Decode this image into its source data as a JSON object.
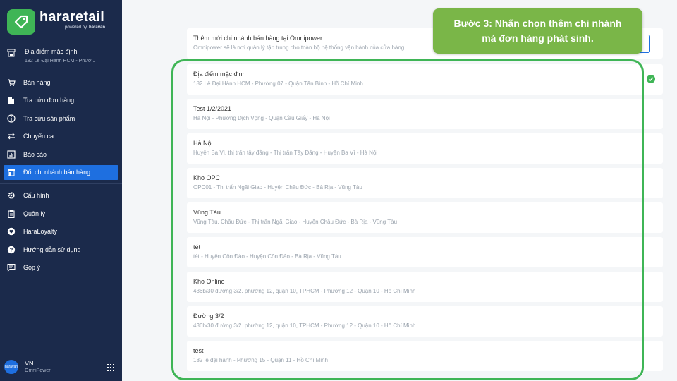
{
  "sidebar": {
    "logo_name": "hararetail",
    "logo_powered": "powered by",
    "logo_brand": "haravan",
    "location_title": "Địa điểm mặc định",
    "location_address": "182 Lê Đại Hành HCM - Phườ...",
    "menu": [
      {
        "label": "Bán hàng",
        "icon": "cart-icon"
      },
      {
        "label": "Tra cứu đơn hàng",
        "icon": "document-icon"
      },
      {
        "label": "Tra cứu sản phẩm",
        "icon": "info-icon"
      },
      {
        "label": "Chuyển ca",
        "icon": "swap-icon"
      },
      {
        "label": "Báo cáo",
        "icon": "chart-icon"
      },
      {
        "label": "Đổi chi nhánh bán hàng",
        "icon": "store-icon",
        "active": true
      }
    ],
    "menu2": [
      {
        "label": "Cấu hình",
        "icon": "gear-icon"
      },
      {
        "label": "Quản lý",
        "icon": "clipboard-icon"
      },
      {
        "label": "HaraLoyalty",
        "icon": "heart-icon"
      },
      {
        "label": "Hướng dẫn sử dụng",
        "icon": "help-icon"
      },
      {
        "label": "Góp ý",
        "icon": "feedback-icon"
      }
    ],
    "footer_user": "VN",
    "footer_org": "OmniPower",
    "avatar_text": "haravan"
  },
  "main": {
    "top_title": "Thêm mới chi nhánh bán hàng tại Omnipower",
    "top_desc": "Omnipower sẽ là nơi quản lý tập trung cho toàn bộ hệ thống vận hành của cửa hàng.",
    "branches": [
      {
        "name": "Địa điểm mặc định",
        "address": "182 Lê Đại Hành HCM - Phường 07 - Quận Tân Bình - Hồ Chí Minh"
      },
      {
        "name": "Test 1/2/2021",
        "address": "Hà Nội - Phường Dịch Vọng - Quận Cầu Giấy - Hà Nội"
      },
      {
        "name": "Hà Nội",
        "address": "Huyện Ba Vì, thị trấn tây đằng - Thị trấn Tây Đằng - Huyện Ba Vì - Hà Nội"
      },
      {
        "name": "Kho OPC",
        "address": "OPC01 - Thị trấn Ngãi Giao - Huyện Châu Đức - Bà Rịa - Vũng Tàu"
      },
      {
        "name": "Vũng Tàu",
        "address": "Vũng Tàu, Châu Đức - Thị trấn Ngãi Giao - Huyện Châu Đức - Bà Rịa - Vũng Tàu"
      },
      {
        "name": "tét",
        "address": "tét - Huyện Côn Đảo - Huyện Côn Đảo - Bà Rịa - Vũng Tàu"
      },
      {
        "name": "Kho Online",
        "address": "436b/30 đường 3/2. phường 12, quận 10, TPHCM - Phường 12 - Quận 10 - Hồ Chí Minh"
      },
      {
        "name": "Đường 3/2",
        "address": "436b/30 đường 3/2. phường 12, quận 10, TPHCM - Phường 12 - Quận 10 - Hồ Chí Minh"
      },
      {
        "name": "test",
        "address": "182 lê đại hành - Phường 15 - Quận 11 - Hồ Chí Minh"
      }
    ]
  },
  "callout": {
    "line1": "Bước 3: Nhấn chọn thêm chi nhánh",
    "line2": "mà đơn hàng phát sinh."
  },
  "colors": {
    "sidebar_bg": "#1b2a4b",
    "active_bg": "#1e6fe0",
    "accent_green": "#3fb556",
    "callout_bg": "#7ab648"
  }
}
